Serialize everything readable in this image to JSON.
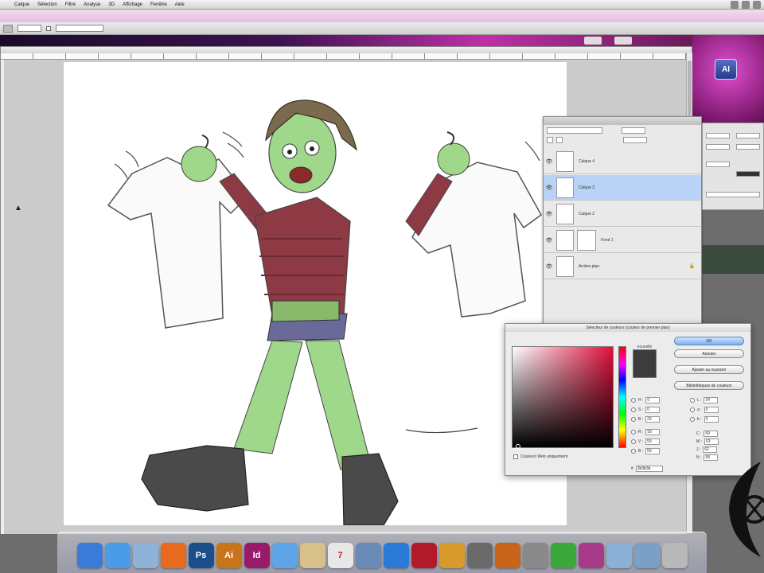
{
  "menubar": {
    "apple": "",
    "items": [
      {
        "label": "Calque"
      },
      {
        "label": "Sélection"
      },
      {
        "label": "Filtre"
      },
      {
        "label": "Analyse"
      },
      {
        "label": "3D"
      },
      {
        "label": "Affichage"
      },
      {
        "label": "Fenêtre"
      },
      {
        "label": "Aide"
      }
    ]
  },
  "desktop": {
    "icon_label": "AI",
    "icon_name": "illustrator-file-icon"
  },
  "layers": {
    "rows": [
      {
        "name": "Calque 4",
        "visible": true,
        "selected": false
      },
      {
        "name": "Calque 3",
        "visible": true,
        "selected": true
      },
      {
        "name": "Calque 2",
        "visible": true,
        "selected": false
      },
      {
        "name": "Fond 1",
        "visible": true,
        "selected": false,
        "has_mask": true
      },
      {
        "name": "Arrière-plan",
        "visible": true,
        "selected": false
      }
    ]
  },
  "picker": {
    "title": "Sélecteur de couleurs (couleur de premier plan)",
    "swatch_label": "nouvelle",
    "buttons": {
      "ok": "OK",
      "cancel": "Annuler",
      "add_swatches": "Ajouter au nuancier",
      "color_libraries": "Bibliothèques de couleurs"
    },
    "web_only": "Couleurs Web uniquement",
    "hsb": [
      {
        "label": "H :",
        "value": "0"
      },
      {
        "label": "S :",
        "value": "0"
      },
      {
        "label": "B :",
        "value": "23"
      }
    ],
    "rgb": [
      {
        "label": "R :",
        "value": "59"
      },
      {
        "label": "V :",
        "value": "59"
      },
      {
        "label": "B :",
        "value": "59"
      }
    ],
    "lab": [
      {
        "label": "L :",
        "value": "24"
      },
      {
        "label": "a :",
        "value": "0"
      },
      {
        "label": "b :",
        "value": "0"
      }
    ],
    "cmjn": [
      {
        "label": "C :",
        "value": "69"
      },
      {
        "label": "M :",
        "value": "63"
      },
      {
        "label": "J :",
        "value": "62"
      },
      {
        "label": "N :",
        "value": "58"
      }
    ],
    "hex": "3b3b3b",
    "colors": {
      "selected": "#3c3c3c",
      "hue": "#e0103c"
    }
  },
  "dock": {
    "icons": [
      {
        "name": "finder-icon",
        "label": "",
        "color": "#3b7bd8"
      },
      {
        "name": "safari-icon",
        "label": "",
        "color": "#4a9be8"
      },
      {
        "name": "mail-icon",
        "label": "",
        "color": "#8fb3d8"
      },
      {
        "name": "firefox-icon",
        "label": "",
        "color": "#e86a1e"
      },
      {
        "name": "photoshop-icon",
        "label": "Ps",
        "color": "#1b4f8c"
      },
      {
        "name": "illustrator-icon",
        "label": "Ai",
        "color": "#c8741a"
      },
      {
        "name": "indesign-icon",
        "label": "Id",
        "color": "#9a1a6a"
      },
      {
        "name": "ichat-icon",
        "label": "",
        "color": "#5da4e8"
      },
      {
        "name": "preview-icon",
        "label": "",
        "color": "#d8c08a"
      },
      {
        "name": "ical-icon",
        "label": "7",
        "color": "#e8e8e8"
      },
      {
        "name": "iphoto-icon",
        "label": "",
        "color": "#6a8ab8"
      },
      {
        "name": "itunes-icon",
        "label": "",
        "color": "#2a7ad8"
      },
      {
        "name": "flash-icon",
        "label": "",
        "color": "#b01a2a"
      },
      {
        "name": "games-icon",
        "label": "",
        "color": "#d89a2a"
      },
      {
        "name": "shuriken-icon",
        "label": "",
        "color": "#6a6a6a"
      },
      {
        "name": "guitar-icon",
        "label": "",
        "color": "#c8641a"
      },
      {
        "name": "system-preferences-icon",
        "label": "",
        "color": "#8a8a8a"
      },
      {
        "name": "utorrent-icon",
        "label": "",
        "color": "#3aa83a"
      },
      {
        "name": "photo-booth-icon",
        "label": "",
        "color": "#a83a8a"
      },
      {
        "name": "documents-stack-icon",
        "label": "",
        "color": "#8ab0d8"
      },
      {
        "name": "downloads-stack-icon",
        "label": "",
        "color": "#7aa0c8"
      },
      {
        "name": "trash-icon",
        "label": "",
        "color": "#b8b8b8"
      }
    ]
  }
}
